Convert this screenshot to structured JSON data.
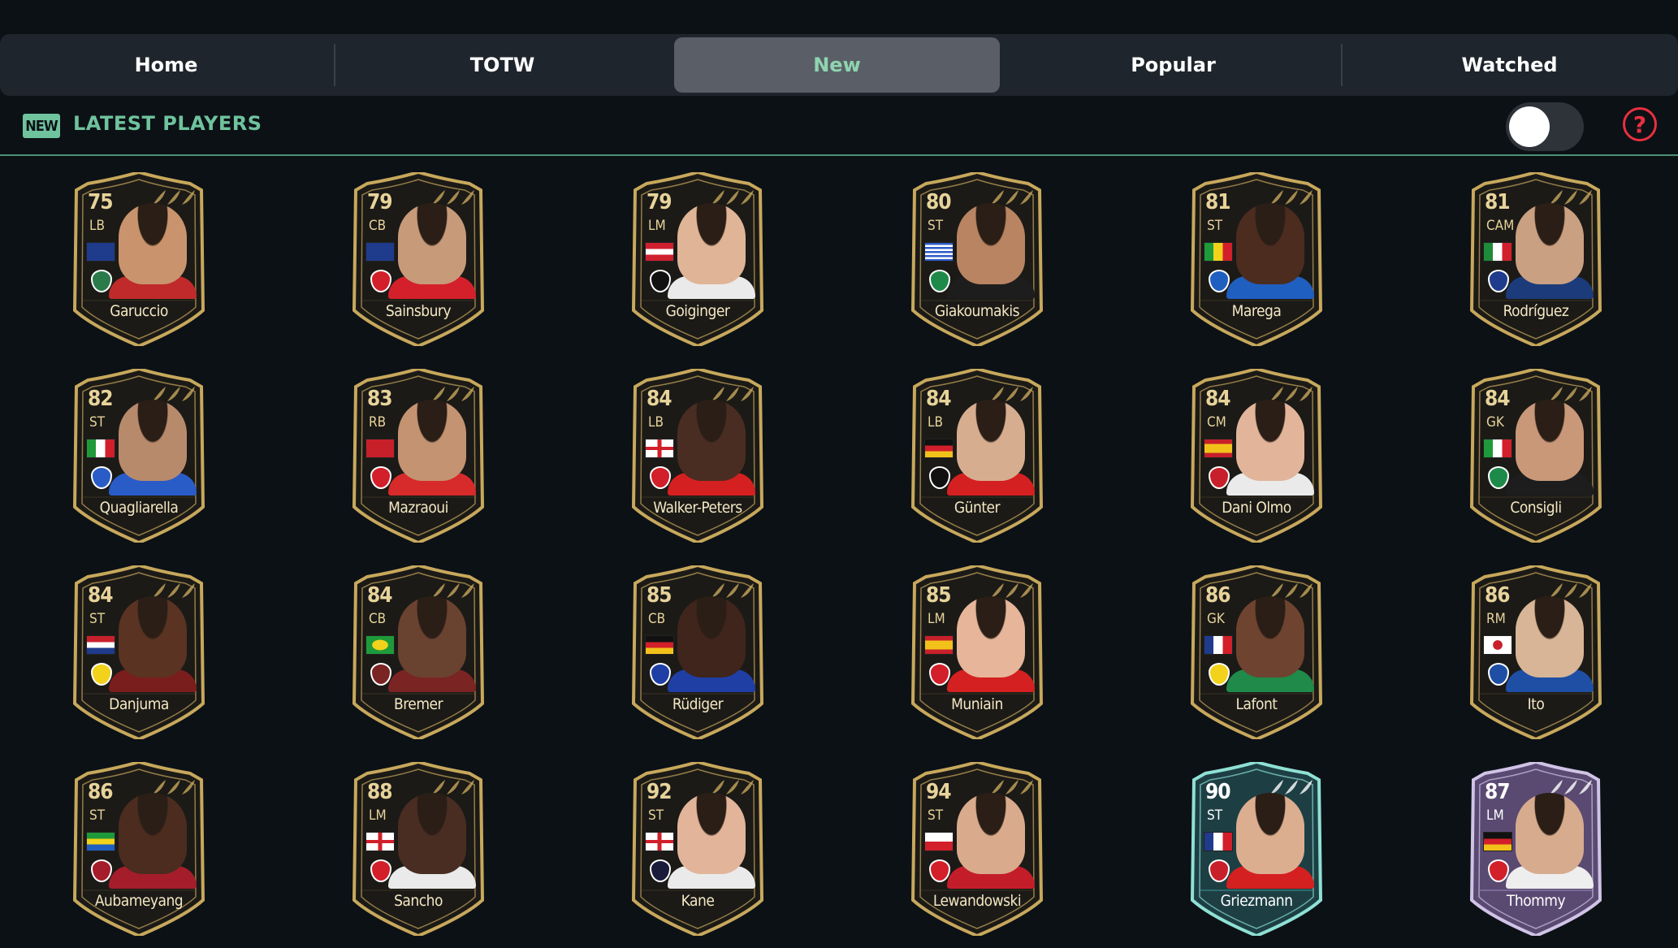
{
  "tabs": [
    {
      "label": "Home",
      "active": false
    },
    {
      "label": "TOTW",
      "active": false
    },
    {
      "label": "New",
      "active": true
    },
    {
      "label": "Popular",
      "active": false
    },
    {
      "label": "Watched",
      "active": false
    }
  ],
  "section": {
    "badge": "NEW",
    "title": "LATEST PLAYERS",
    "toggle_on": false,
    "help_symbol": "?"
  },
  "colors": {
    "background": "#0c1116",
    "accent_green": "#6fc39d",
    "active_tab_bg": "#5a5f67",
    "help_red": "#e8303f",
    "card_gold": "#c7a85c",
    "card_dark": "#1b1a17"
  },
  "players": [
    {
      "rating": "75",
      "position": "LB",
      "name": "Garuccio",
      "flag": "australia",
      "club": "western-united",
      "card": "totw",
      "skin": "#c9946d",
      "shirt": "#c02a2a"
    },
    {
      "rating": "79",
      "position": "CB",
      "name": "Sainsbury",
      "flag": "australia",
      "club": "kortrijk",
      "card": "totw",
      "skin": "#c79a7a",
      "shirt": "#d4202a"
    },
    {
      "rating": "79",
      "position": "LM",
      "name": "Goiginger",
      "flag": "austria",
      "club": "lask",
      "card": "totw",
      "skin": "#e0b496",
      "shirt": "#eaeaea"
    },
    {
      "rating": "80",
      "position": "ST",
      "name": "Giakoumakis",
      "flag": "greece",
      "club": "celtic",
      "card": "totw",
      "skin": "#b88462",
      "shirt": "#1d1d1d"
    },
    {
      "rating": "81",
      "position": "ST",
      "name": "Marega",
      "flag": "mali",
      "club": "al-hilal",
      "card": "totw",
      "skin": "#4b2c1f",
      "shirt": "#1f5fc0"
    },
    {
      "rating": "81",
      "position": "CAM",
      "name": "Rodríguez",
      "flag": "mexico",
      "club": "cruz-azul",
      "card": "totw",
      "skin": "#caa082",
      "shirt": "#1b3b7a"
    },
    {
      "rating": "82",
      "position": "ST",
      "name": "Quagliarella",
      "flag": "italy",
      "club": "sampdoria",
      "card": "totw",
      "skin": "#b88a6c",
      "shirt": "#2a5cc7"
    },
    {
      "rating": "83",
      "position": "RB",
      "name": "Mazraoui",
      "flag": "morocco",
      "club": "ajax",
      "card": "totw",
      "skin": "#c49372",
      "shirt": "#d72a2a"
    },
    {
      "rating": "84",
      "position": "LB",
      "name": "Walker-Peters",
      "flag": "england",
      "club": "southampton",
      "card": "totw",
      "skin": "#4a2d22",
      "shirt": "#d42020"
    },
    {
      "rating": "84",
      "position": "LB",
      "name": "Günter",
      "flag": "germany",
      "club": "freiburg",
      "card": "totw",
      "skin": "#d7ad90",
      "shirt": "#d42020"
    },
    {
      "rating": "84",
      "position": "CM",
      "name": "Dani Olmo",
      "flag": "spain",
      "club": "rb-leipzig",
      "card": "totw",
      "skin": "#e2b59a",
      "shirt": "#eaeaea"
    },
    {
      "rating": "84",
      "position": "GK",
      "name": "Consigli",
      "flag": "italy",
      "club": "sassuolo",
      "card": "totw",
      "skin": "#c99878",
      "shirt": "#1d1d1d"
    },
    {
      "rating": "84",
      "position": "ST",
      "name": "Danjuma",
      "flag": "netherlands",
      "club": "villarreal",
      "card": "totw",
      "skin": "#5a3322",
      "shirt": "#7a1d1d"
    },
    {
      "rating": "84",
      "position": "CB",
      "name": "Bremer",
      "flag": "brazil",
      "club": "torino",
      "card": "totw",
      "skin": "#6a4230",
      "shirt": "#7b2424"
    },
    {
      "rating": "85",
      "position": "CB",
      "name": "Rüdiger",
      "flag": "germany",
      "club": "chelsea",
      "card": "totw",
      "skin": "#3f251b",
      "shirt": "#1f3fa5"
    },
    {
      "rating": "85",
      "position": "LM",
      "name": "Muniain",
      "flag": "spain",
      "club": "athletic",
      "card": "totw",
      "skin": "#e6b59a",
      "shirt": "#d42020"
    },
    {
      "rating": "86",
      "position": "GK",
      "name": "Lafont",
      "flag": "france",
      "club": "nantes",
      "card": "totw",
      "skin": "#6e4330",
      "shirt": "#1f8a4a"
    },
    {
      "rating": "86",
      "position": "RM",
      "name": "Ito",
      "flag": "japan",
      "club": "genk",
      "card": "totw",
      "skin": "#d8b596",
      "shirt": "#1f4fa5"
    },
    {
      "rating": "86",
      "position": "ST",
      "name": "Aubameyang",
      "flag": "gabon",
      "club": "barcelona",
      "card": "totw",
      "skin": "#4b2c1f",
      "shirt": "#a51d2a"
    },
    {
      "rating": "88",
      "position": "LM",
      "name": "Sancho",
      "flag": "england",
      "club": "man-utd",
      "card": "totw",
      "skin": "#4a2d22",
      "shirt": "#eaeaea"
    },
    {
      "rating": "92",
      "position": "ST",
      "name": "Kane",
      "flag": "england",
      "club": "tottenham",
      "card": "totw",
      "skin": "#e2b49a",
      "shirt": "#eaeaea"
    },
    {
      "rating": "94",
      "position": "ST",
      "name": "Lewandowski",
      "flag": "poland",
      "club": "bayern",
      "card": "totw",
      "skin": "#d9ab8c",
      "shirt": "#c41d2a"
    },
    {
      "rating": "90",
      "position": "ST",
      "name": "Griezmann",
      "flag": "france",
      "club": "atletico",
      "card": "flashback",
      "skin": "#dcae90",
      "shirt": "#d42020"
    },
    {
      "rating": "87",
      "position": "LM",
      "name": "Thommy",
      "flag": "germany",
      "club": "stuttgart",
      "card": "purple",
      "skin": "#d7ab8e",
      "shirt": "#eeeeee"
    }
  ]
}
